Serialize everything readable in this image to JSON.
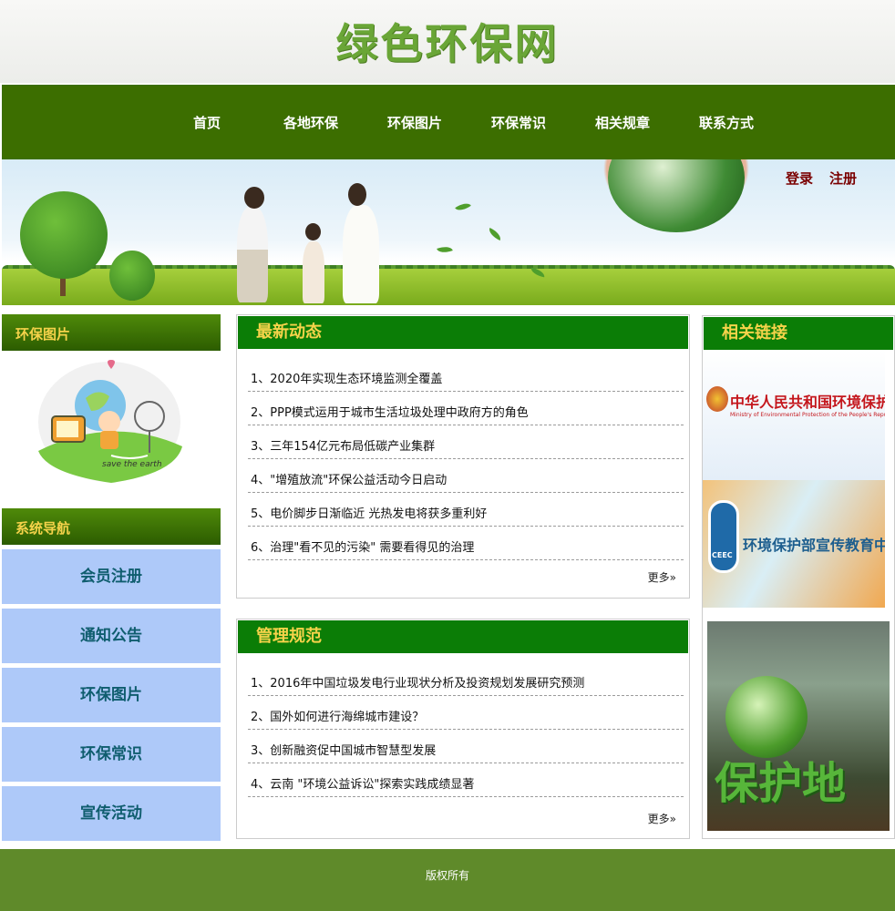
{
  "site": {
    "logo_text": "绿色环保网"
  },
  "nav": {
    "items": [
      "首页",
      "各地环保",
      "环保图片",
      "环保常识",
      "相关规章",
      "联系方式"
    ]
  },
  "auth": {
    "login": "登录",
    "register": "注册"
  },
  "sidebar": {
    "photos_title": "环保图片",
    "photo_caption": "save the earth",
    "nav_title": "系统导航",
    "menu": [
      "会员注册",
      "通知公告",
      "环保图片",
      "环保常识",
      "宣传活动"
    ]
  },
  "latest": {
    "title": "最新动态",
    "items": [
      "1、2020年实现生态环境监测全覆盖",
      "2、PPP模式运用于城市生活垃圾处理中政府方的角色",
      "3、三年154亿元布局低碳产业集群",
      "4、\"增殖放流\"环保公益活动今日启动",
      "5、电价脚步日渐临近 光热发电将获多重利好",
      "6、治理\"看不见的污染\" 需要看得见的治理"
    ],
    "more": "更多»"
  },
  "rules": {
    "title": "管理规范",
    "items": [
      "1、2016年中国垃圾发电行业现状分析及投资规划发展研究预测",
      "2、国外如何进行海绵城市建设？",
      "3、创新融资促中国城市智慧型发展",
      "4、云南 \"环境公益诉讼\"探索实践成绩显著"
    ],
    "more": "更多»"
  },
  "links": {
    "title": "相关链接",
    "mep_cn": "中华人民共和国环境保护部",
    "mep_en": "Ministry of Environmental Protection of the People's Republic of China",
    "cepc_text": "环境保护部宣传教育中心",
    "cepc_badge": "CEEC",
    "poster_text": "保护地"
  },
  "footer": {
    "text": "版权所有"
  },
  "colors": {
    "nav": "#3c6e00",
    "panel_head": "#0b7d06",
    "title_yellow": "#f6d34a",
    "menu_bg": "#aec9f9",
    "footer": "#5f8a2a"
  }
}
